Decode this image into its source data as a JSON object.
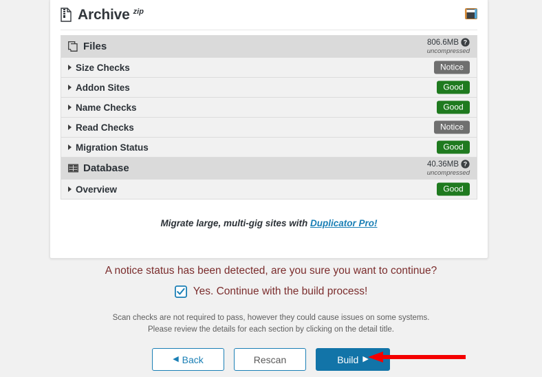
{
  "page": {
    "background_color": "#f1f1f1",
    "card_background": "#ffffff"
  },
  "header": {
    "icon": "file-zip-icon",
    "title": "Archive",
    "superscript": "zip",
    "right_icon": "archive-box-icon"
  },
  "sections": [
    {
      "id": "files",
      "icon": "files-copy-icon",
      "label": "Files",
      "size": "806.6MB",
      "size_note": "uncompressed",
      "help_icon": "question-circle-icon",
      "rows": [
        {
          "label": "Size Checks",
          "status": "Notice",
          "status_type": "notice"
        },
        {
          "label": "Addon Sites",
          "status": "Good",
          "status_type": "good"
        },
        {
          "label": "Name Checks",
          "status": "Good",
          "status_type": "good"
        },
        {
          "label": "Read Checks",
          "status": "Notice",
          "status_type": "notice"
        },
        {
          "label": "Migration Status",
          "status": "Good",
          "status_type": "good"
        }
      ]
    },
    {
      "id": "database",
      "icon": "database-table-icon",
      "label": "Database",
      "size": "40.36MB",
      "size_note": "uncompressed",
      "help_icon": "question-circle-icon",
      "rows": [
        {
          "label": "Overview",
          "status": "Good",
          "status_type": "good"
        }
      ]
    }
  ],
  "promo": {
    "text_before": "Migrate large, multi-gig sites with ",
    "link_text": "Duplicator Pro!",
    "link_color": "#1a7fb5"
  },
  "notice": {
    "question": "A notice status has been detected, are you sure you want to continue?",
    "checkbox_label": "Yes. Continue with the build process!",
    "checkbox_checked": true,
    "checkbox_color": "#1a7fb5",
    "text_color": "#7b2d2d",
    "note_line_1": "Scan checks are not required to pass, however they could cause issues on some systems.",
    "note_line_2": "Please review the details for each section by clicking on the detail title."
  },
  "buttons": {
    "back": {
      "label": "Back",
      "glyph": "◀"
    },
    "rescan": {
      "label": "Rescan"
    },
    "build": {
      "label": "Build",
      "glyph": "▶",
      "color": "#1274a8"
    }
  },
  "annotation": {
    "arrow": "red-left-arrow",
    "color": "#f40000"
  },
  "badge_colors": {
    "good": "#1f7a1f",
    "notice": "#6f6f6f"
  }
}
